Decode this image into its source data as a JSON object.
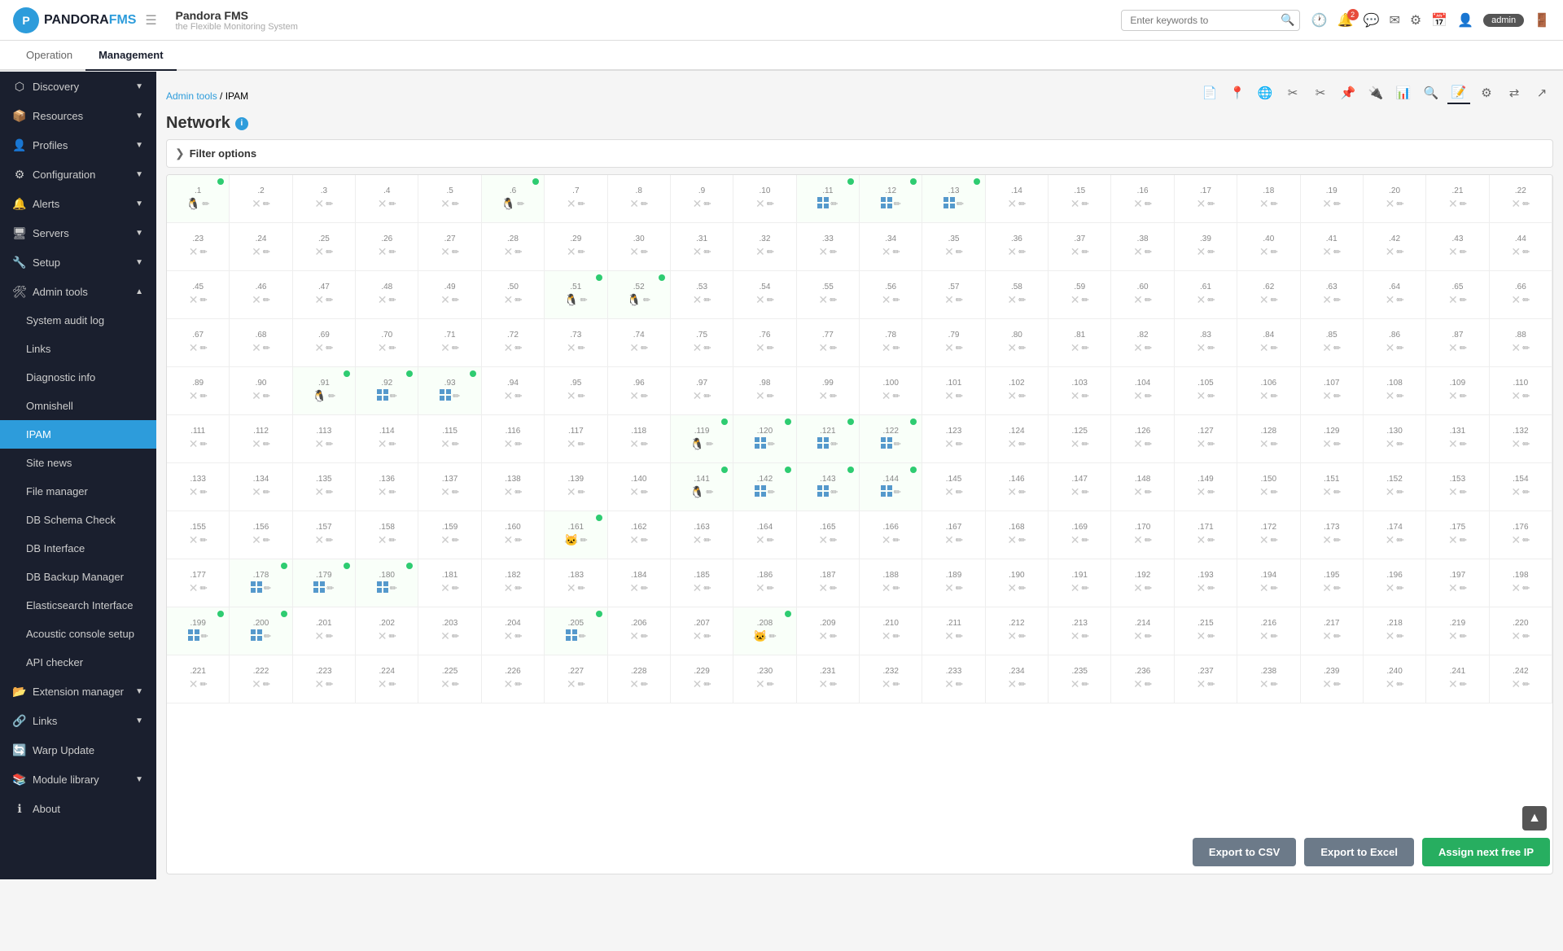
{
  "app": {
    "name": "Pandora FMS",
    "subtitle": "the Flexible Monitoring System",
    "search_placeholder": "Enter keywords to"
  },
  "header": {
    "tabs": [
      "Operation",
      "Management"
    ],
    "active_tab": "Management",
    "icons": [
      "clock",
      "bell",
      "chat",
      "envelope",
      "gear",
      "calendar",
      "user",
      "admin"
    ],
    "admin_label": "admin",
    "notification_count": "2"
  },
  "breadcrumb": {
    "path": "Admin tools",
    "current": "IPAM"
  },
  "page": {
    "title": "Network",
    "filter_label": "Filter options"
  },
  "sidebar": {
    "items": [
      {
        "id": "discovery",
        "label": "Discovery",
        "icon": "🔍",
        "has_arrow": true
      },
      {
        "id": "resources",
        "label": "Resources",
        "icon": "📦",
        "has_arrow": true
      },
      {
        "id": "profiles",
        "label": "Profiles",
        "icon": "👤",
        "has_arrow": true
      },
      {
        "id": "configuration",
        "label": "Configuration",
        "icon": "⚙️",
        "has_arrow": true
      },
      {
        "id": "alerts",
        "label": "Alerts",
        "icon": "🔔",
        "has_arrow": true
      },
      {
        "id": "servers",
        "label": "Servers",
        "icon": "🖥",
        "has_arrow": true
      },
      {
        "id": "setup",
        "label": "Setup",
        "icon": "🔧",
        "has_arrow": true
      },
      {
        "id": "admin-tools",
        "label": "Admin tools",
        "icon": "🛠",
        "has_arrow": true,
        "expanded": true
      },
      {
        "id": "system-audit",
        "label": "System audit log",
        "sub": true
      },
      {
        "id": "links",
        "label": "Links",
        "sub": true
      },
      {
        "id": "diagnostic",
        "label": "Diagnostic info",
        "sub": true
      },
      {
        "id": "omnishell",
        "label": "Omnishell",
        "sub": true
      },
      {
        "id": "ipam",
        "label": "IPAM",
        "sub": true,
        "active": true
      },
      {
        "id": "site-news",
        "label": "Site news",
        "sub": true
      },
      {
        "id": "file-manager",
        "label": "File manager",
        "sub": true
      },
      {
        "id": "db-schema",
        "label": "DB Schema Check",
        "sub": true
      },
      {
        "id": "db-interface",
        "label": "DB Interface",
        "sub": true
      },
      {
        "id": "db-backup",
        "label": "DB Backup Manager",
        "sub": true
      },
      {
        "id": "elasticsearch",
        "label": "Elasticsearch Interface",
        "sub": true
      },
      {
        "id": "acoustic",
        "label": "Acoustic console setup",
        "sub": true
      },
      {
        "id": "api-checker",
        "label": "API checker",
        "sub": true
      },
      {
        "id": "extension-manager",
        "label": "Extension manager",
        "sub": true,
        "has_arrow": true
      },
      {
        "id": "links2",
        "label": "Links",
        "has_arrow": true
      },
      {
        "id": "warp-update",
        "label": "Warp Update"
      },
      {
        "id": "module-library",
        "label": "Module library",
        "has_arrow": true
      },
      {
        "id": "about",
        "label": "About"
      }
    ]
  },
  "toolbar": {
    "icons": [
      "file",
      "location",
      "tree",
      "tools",
      "cut",
      "pin",
      "network",
      "table",
      "search",
      "edit",
      "config",
      "arrows",
      "external"
    ]
  },
  "buttons": {
    "export_csv": "Export to CSV",
    "export_excel": "Export to Excel",
    "assign_ip": "Assign next free IP"
  },
  "ip_grid": {
    "rows": [
      [
        ".1",
        ".2",
        ".3",
        ".4",
        ".5",
        ".6",
        ".7",
        ".8",
        ".9",
        ".10",
        ".11",
        ".12",
        ".13",
        ".14",
        ".15",
        ".16",
        ".17",
        ".18",
        ".19",
        ".20",
        ".21",
        ".22"
      ],
      [
        ".23",
        ".24",
        ".25",
        ".26",
        ".27",
        ".28",
        ".29",
        ".30",
        ".31",
        ".32",
        ".33",
        ".34",
        ".35",
        ".36",
        ".37",
        ".38",
        ".39",
        ".40",
        ".41",
        ".42",
        ".43",
        ".44"
      ],
      [
        ".45",
        ".46",
        ".47",
        ".48",
        ".49",
        ".50",
        ".51",
        ".52",
        ".53",
        ".54",
        ".55",
        ".56",
        ".57",
        ".58",
        ".59",
        ".60",
        ".61",
        ".62",
        ".63",
        ".64",
        ".65",
        ".66"
      ],
      [
        ".67",
        ".68",
        ".69",
        ".70",
        ".71",
        ".72",
        ".73",
        ".74",
        ".75",
        ".76",
        ".77",
        ".78",
        ".79",
        ".80",
        ".81",
        ".82",
        ".83",
        ".84",
        ".85",
        ".86",
        ".87",
        ".88"
      ],
      [
        ".89",
        ".90",
        ".91",
        ".92",
        ".93",
        ".94",
        ".95",
        ".96",
        ".97",
        ".98",
        ".99",
        ".100",
        ".101",
        ".102",
        ".103",
        ".104",
        ".105",
        ".106",
        ".107",
        ".108",
        ".109",
        ".110"
      ],
      [
        ".111",
        ".112",
        ".113",
        ".114",
        ".115",
        ".116",
        ".117",
        ".118",
        ".119",
        ".120",
        ".121",
        ".122",
        ".123",
        ".124",
        ".125",
        ".126",
        ".127",
        ".128",
        ".129",
        ".130",
        ".131",
        ".132"
      ],
      [
        ".133",
        ".134",
        ".135",
        ".136",
        ".137",
        ".138",
        ".139",
        ".140",
        ".141",
        ".142",
        ".143",
        ".144",
        ".145",
        ".146",
        ".147",
        ".148",
        ".149",
        ".150",
        ".151",
        ".152",
        ".153",
        ".154"
      ],
      [
        ".155",
        ".156",
        ".157",
        ".158",
        ".159",
        ".160",
        ".161",
        ".162",
        ".163",
        ".164",
        ".165",
        ".166",
        ".167",
        ".168",
        ".169",
        ".170",
        ".171",
        ".172",
        ".173",
        ".174",
        ".175",
        ".176"
      ],
      [
        ".177",
        ".178",
        ".179",
        ".180",
        ".181",
        ".182",
        ".183",
        ".184",
        ".185",
        ".186",
        ".187",
        ".188",
        ".189",
        ".190",
        ".191",
        ".192",
        ".193",
        ".194",
        ".195",
        ".196",
        ".197",
        ".198"
      ],
      [
        ".199",
        ".200",
        ".201",
        ".202",
        ".203",
        ".204",
        ".205",
        ".206",
        ".207",
        ".208",
        ".209",
        ".210",
        ".211",
        ".212",
        ".213",
        ".214",
        ".215",
        ".216",
        ".217",
        ".218",
        ".219",
        ".220"
      ],
      [
        ".221",
        ".222",
        ".223",
        ".224",
        ".225",
        ".226",
        ".227",
        ".228",
        ".229",
        ".230",
        ".231",
        ".232",
        ".233",
        ".234",
        ".235",
        ".236",
        ".237",
        ".238",
        ".239",
        ".240",
        ".241",
        ".242"
      ]
    ]
  }
}
